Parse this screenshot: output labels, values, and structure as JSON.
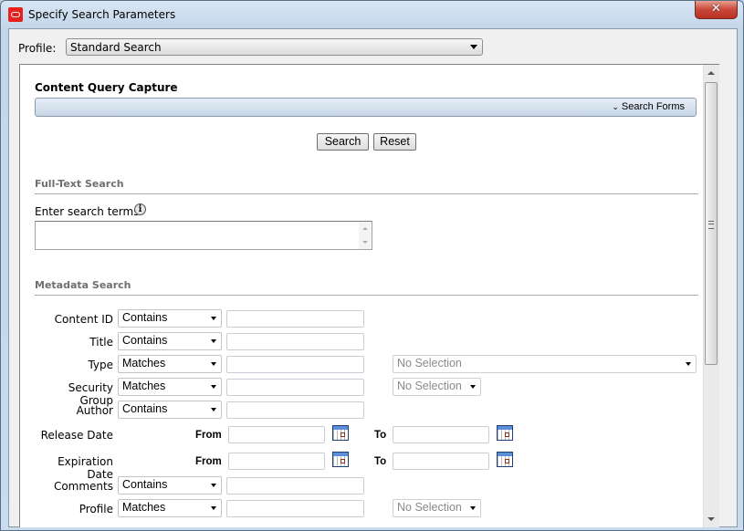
{
  "window": {
    "title": "Specify Search Parameters",
    "close_label": "✕"
  },
  "profile": {
    "label": "Profile:",
    "value": "Standard Search"
  },
  "panel": {
    "title": "Content Query Capture",
    "search_forms_label": "Search Forms",
    "search_forms_chevron": "⌄",
    "search_button": "Search",
    "reset_button": "Reset"
  },
  "fulltext": {
    "section_title": "Full-Text Search",
    "terms_label": "Enter search terms",
    "info_icon": "i",
    "terms_value": ""
  },
  "metadata": {
    "section_title": "Metadata Search",
    "from_label": "From",
    "to_label": "To",
    "rows": [
      {
        "label": "Content ID",
        "operator": "Contains",
        "value": ""
      },
      {
        "label": "Title",
        "operator": "Contains",
        "value": ""
      },
      {
        "label": "Type",
        "operator": "Matches",
        "value": "",
        "option_select": "No Selection"
      },
      {
        "label": "Security Group",
        "operator": "Matches",
        "value": "",
        "option_select": "No Selection"
      },
      {
        "label": "Author",
        "operator": "Contains",
        "value": ""
      },
      {
        "label": "Release Date",
        "from": "",
        "to": ""
      },
      {
        "label": "Expiration Date",
        "from": "",
        "to": ""
      },
      {
        "label": "Comments",
        "operator": "Contains",
        "value": ""
      },
      {
        "label": "Profile",
        "operator": "Matches",
        "value": "",
        "option_select": "No Selection"
      }
    ]
  }
}
